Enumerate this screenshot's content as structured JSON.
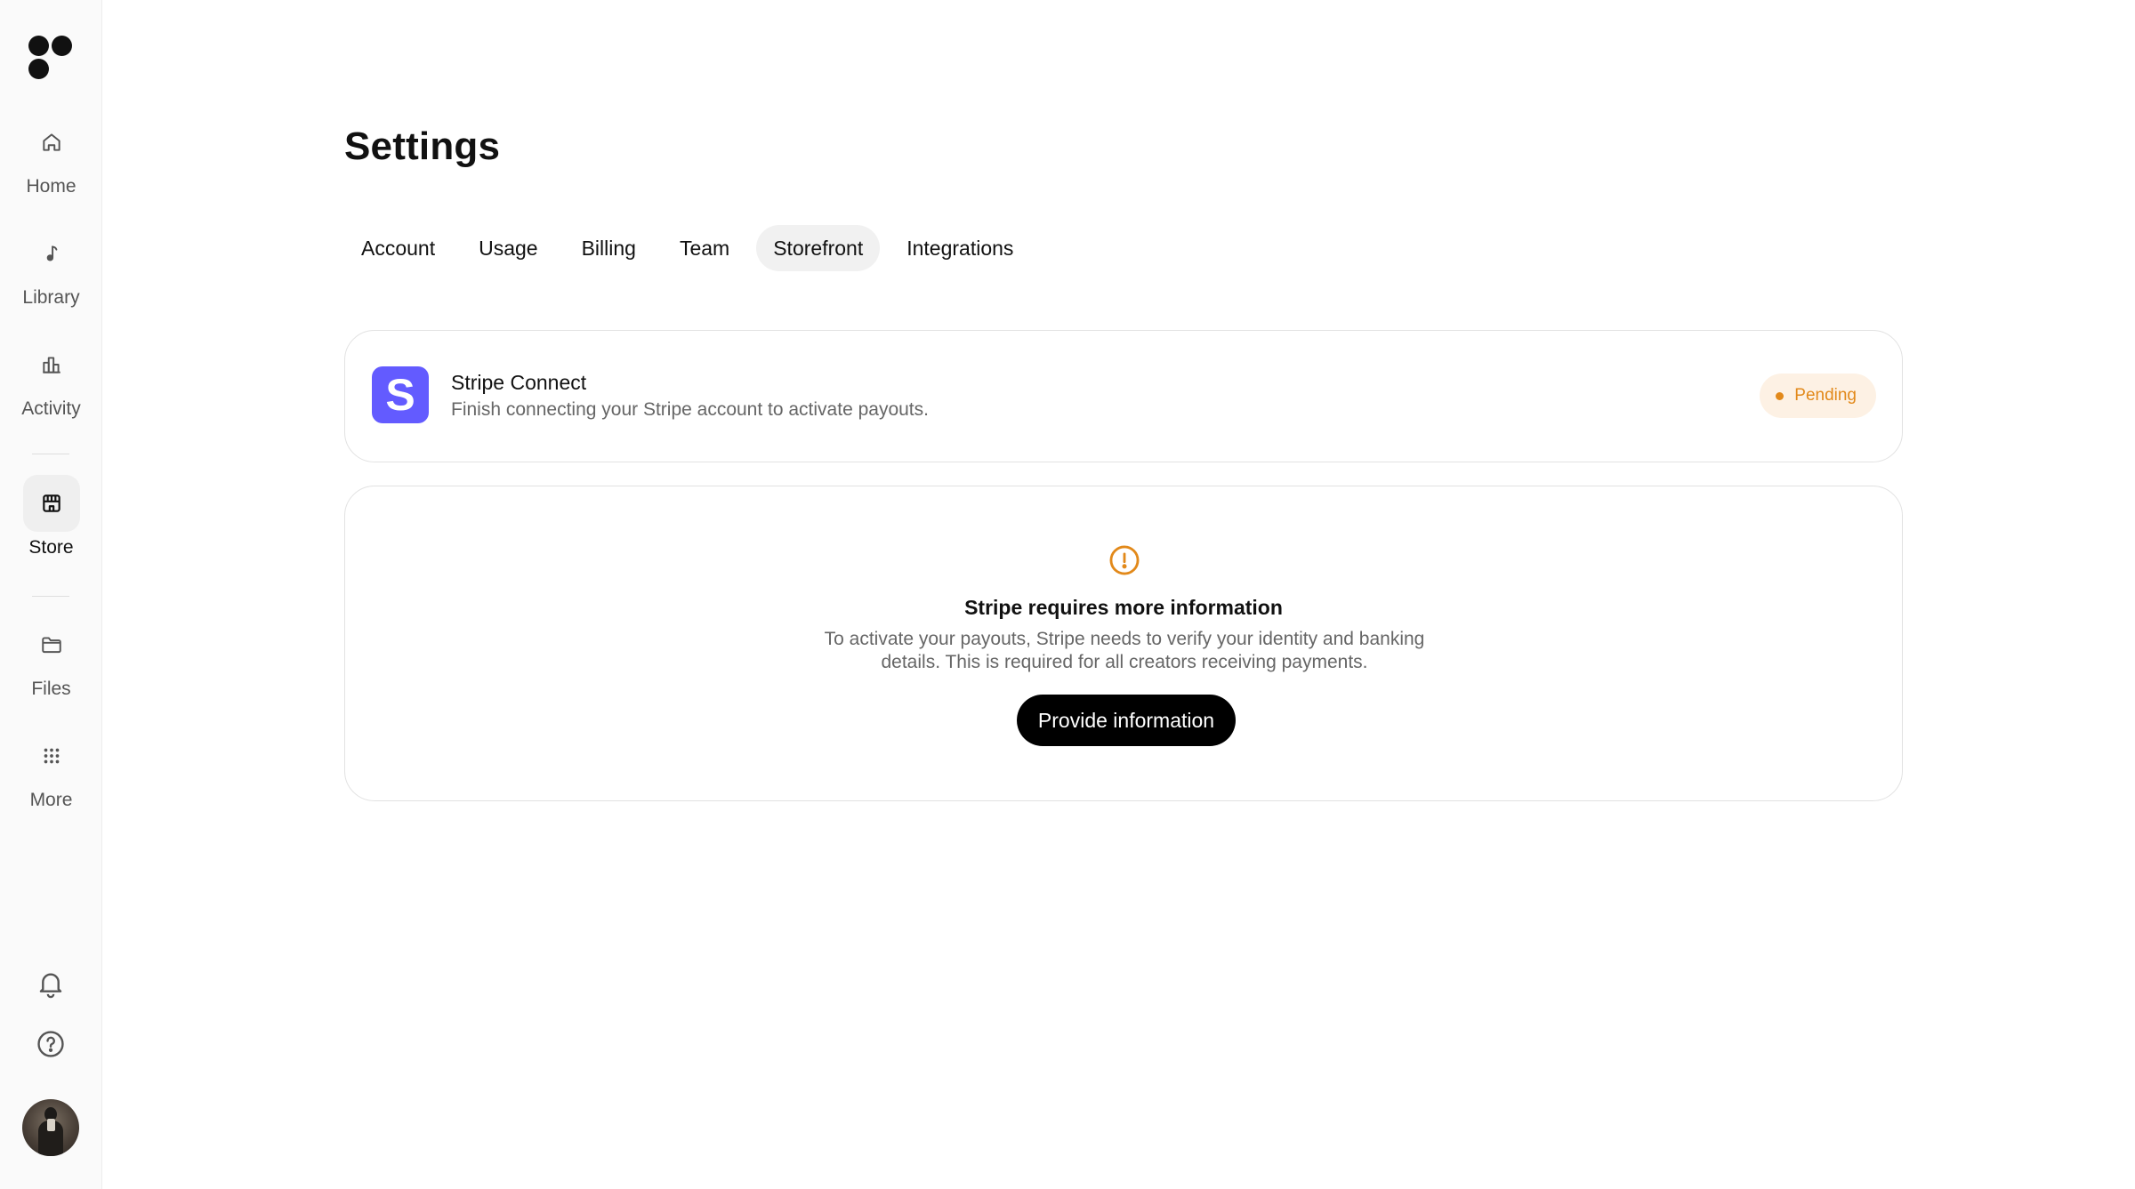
{
  "sidebar": {
    "nav": [
      {
        "label": "Home",
        "icon": "home-icon"
      },
      {
        "label": "Library",
        "icon": "music-note-icon"
      },
      {
        "label": "Activity",
        "icon": "bar-chart-icon"
      },
      {
        "label": "Store",
        "icon": "store-icon",
        "active": true
      },
      {
        "label": "Files",
        "icon": "folder-icon"
      },
      {
        "label": "More",
        "icon": "grid-dots-icon"
      }
    ],
    "bottom_icons": [
      "bell-icon",
      "help-circle-icon"
    ]
  },
  "page": {
    "title": "Settings"
  },
  "tabs": [
    {
      "label": "Account"
    },
    {
      "label": "Usage"
    },
    {
      "label": "Billing"
    },
    {
      "label": "Team"
    },
    {
      "label": "Storefront",
      "active": true
    },
    {
      "label": "Integrations"
    }
  ],
  "stripe_connect": {
    "logo_letter": "S",
    "title": "Stripe Connect",
    "description": "Finish connecting your Stripe account to activate payouts.",
    "status": "Pending"
  },
  "info_card": {
    "icon": "alert-circle-icon",
    "title": "Stripe requires more information",
    "description": "To activate your payouts, Stripe needs to verify your identity and banking details. This is required for all creators receiving payments.",
    "button_label": "Provide information"
  },
  "colors": {
    "stripe_brand": "#635bff",
    "pending": "#e2891a",
    "pending_bg": "#fdf1e4",
    "primary_button": "#000000"
  }
}
